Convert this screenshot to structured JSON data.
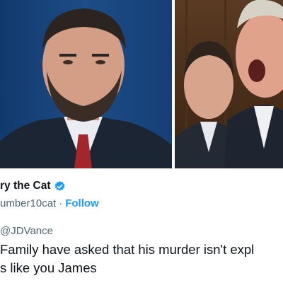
{
  "photos": {
    "left_subject": "man-in-dark-suit-red-tie",
    "right_subject": "man-speaking-in-parliament"
  },
  "tweet": {
    "display_name": "ry the Cat",
    "verified_icon": "verified-badge-icon",
    "handle": "umber10cat",
    "separator": "·",
    "follow_label": "Follow",
    "reply_to": "@JDVance",
    "body_lines": [
      "Family have asked that his murder isn't expl",
      "s like you James"
    ]
  },
  "colors": {
    "accent_blue": "#1d9bf0",
    "text_primary": "#0f1419",
    "text_secondary": "#536471"
  }
}
